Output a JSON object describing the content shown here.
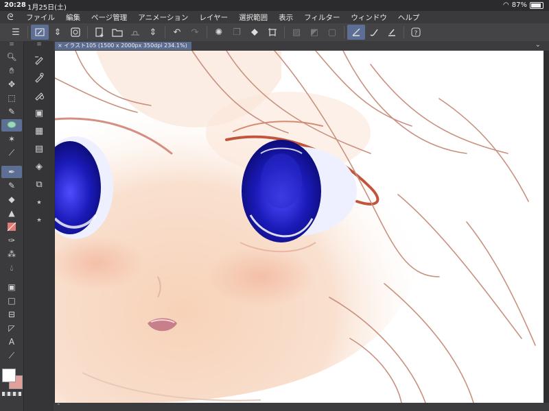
{
  "status": {
    "time": "20:28",
    "date": "1月25日(土)",
    "battery": "87%"
  },
  "menu": {
    "logo_icon": "clip-studio-logo-icon",
    "items": [
      "ファイル",
      "編集",
      "ページ管理",
      "アニメーション",
      "レイヤー",
      "選択範囲",
      "表示",
      "フィルター",
      "ウィンドウ",
      "ヘルプ"
    ]
  },
  "document": {
    "tab_title": "イラスト105 (1500 x 2000px 350dpi 234.1%)",
    "close_glyph": "×"
  },
  "colors": {
    "accent": "#5d6f95",
    "foreground": "#ffffff",
    "background": "#e3a09a"
  }
}
